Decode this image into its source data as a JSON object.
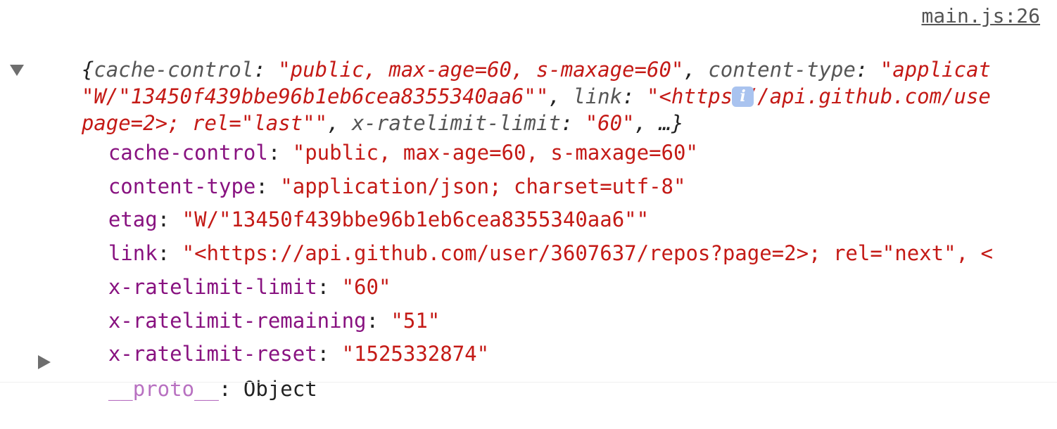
{
  "source": {
    "link": "main.js:26"
  },
  "summary": {
    "line1": {
      "open": "{",
      "k1": "cache-control",
      "sep1": ": ",
      "v1": "\"public, max-age=60, s-maxage=60\"",
      "comma1": ", ",
      "k2": "content-type",
      "sep2": ": ",
      "v2": "\"applicat"
    },
    "line2": {
      "v1": "\"W/\"13450f439bbe96b1eb6cea8355340aa6\"\"",
      "comma1": ", ",
      "k1": "link",
      "sep1": ": ",
      "v2": "\"<https://api.github.com/use"
    },
    "line3": {
      "v1": "page=2>; rel=\"last\"\"",
      "comma1": ", ",
      "k1": "x-ratelimit-limit",
      "sep1": ": ",
      "v2": "\"60\"",
      "tail": ", …}"
    },
    "info_icon": "i"
  },
  "properties": [
    {
      "key": "cache-control",
      "value": "\"public, max-age=60, s-maxage=60\""
    },
    {
      "key": "content-type",
      "value": "\"application/json; charset=utf-8\""
    },
    {
      "key": "etag",
      "value": "\"W/\"13450f439bbe96b1eb6cea8355340aa6\"\""
    },
    {
      "key": "link",
      "value": "\"<https://api.github.com/user/3607637/repos?page=2>; rel=\"next\", <"
    },
    {
      "key": "x-ratelimit-limit",
      "value": "\"60\""
    },
    {
      "key": "x-ratelimit-remaining",
      "value": "\"51\""
    },
    {
      "key": "x-ratelimit-reset",
      "value": "\"1525332874\""
    }
  ],
  "proto": {
    "key": "__proto__",
    "sep": ": ",
    "value": "Object"
  },
  "colors": {
    "string": "#c41a16",
    "key": "#881280",
    "summary_key": "#565656",
    "proto_key": "#b871c1",
    "info_badge": "#a9c3ef"
  }
}
